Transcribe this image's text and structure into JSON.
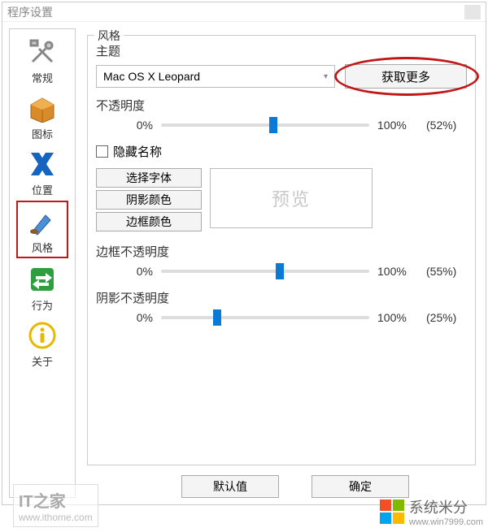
{
  "window": {
    "title": "程序设置"
  },
  "sidebar": {
    "items": [
      {
        "label": "常规"
      },
      {
        "label": "图标"
      },
      {
        "label": "位置"
      },
      {
        "label": "风格"
      },
      {
        "label": "行为"
      },
      {
        "label": "关于"
      }
    ],
    "selected_index": 3
  },
  "style_panel": {
    "group_title": "风格",
    "theme_label": "主题",
    "theme_value": "Mac OS X Leopard",
    "get_more_label": "获取更多",
    "opacity_label": "不透明度",
    "opacity": {
      "min_label": "0%",
      "max_label": "100%",
      "value_pct": 52,
      "value_label": "(52%)"
    },
    "hide_names_label": "隐藏名称",
    "hide_names_checked": false,
    "font_button": "选择字体",
    "shadow_color_button": "阴影颜色",
    "border_color_button": "边框颜色",
    "preview_label": "预览",
    "border_opacity_label": "边框不透明度",
    "border_opacity": {
      "min_label": "0%",
      "max_label": "100%",
      "value_pct": 55,
      "value_label": "(55%)"
    },
    "shadow_opacity_label": "阴影不透明度",
    "shadow_opacity": {
      "min_label": "0%",
      "max_label": "100%",
      "value_pct": 25,
      "value_label": "(25%)"
    }
  },
  "footer": {
    "default_button": "默认值",
    "ok_button": "确定"
  },
  "watermark": {
    "left_small": "www.ithome.com",
    "left_big": "IT之家",
    "right_text": "系统米分",
    "right_sub": "www.win7999.com"
  }
}
